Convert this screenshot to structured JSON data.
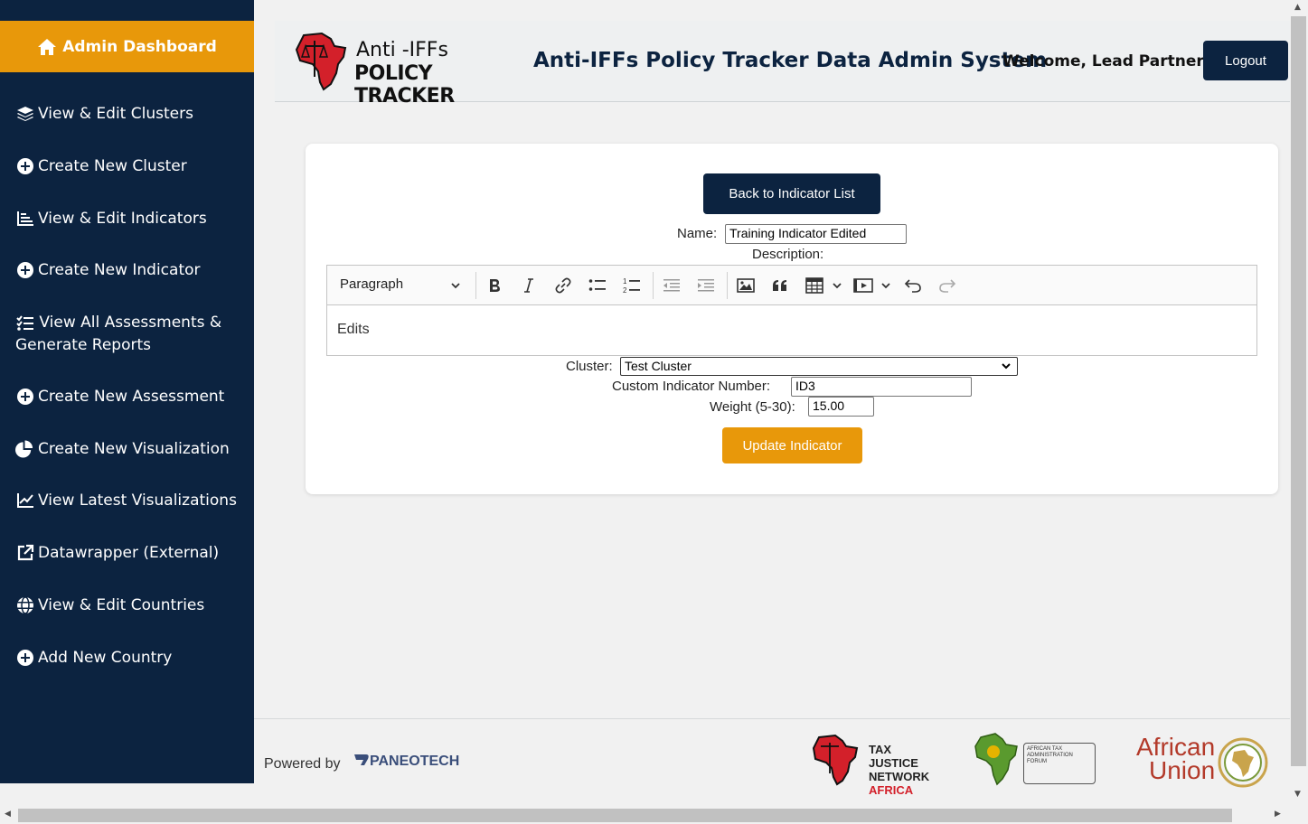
{
  "sidebar": {
    "dashboard_label": "Admin Dashboard",
    "items": [
      {
        "label": "View & Edit Clusters",
        "icon": "layers-icon"
      },
      {
        "label": "Create New Cluster",
        "icon": "plus-circle-icon"
      },
      {
        "label": "View & Edit Indicators",
        "icon": "bar-list-icon"
      },
      {
        "label": "Create New Indicator",
        "icon": "plus-circle-icon"
      },
      {
        "label": "View All Assessments & Generate Reports",
        "icon": "checklist-icon"
      },
      {
        "label": "Create New Assessment",
        "icon": "plus-circle-icon"
      },
      {
        "label": "Create New Visualization",
        "icon": "pie-chart-icon"
      },
      {
        "label": "View Latest Visualizations",
        "icon": "line-chart-icon"
      },
      {
        "label": "Datawrapper (External)",
        "icon": "external-link-icon"
      },
      {
        "label": "View & Edit Countries",
        "icon": "globe-icon"
      },
      {
        "label": "Add New Country",
        "icon": "plus-circle-icon"
      }
    ]
  },
  "header": {
    "logo_line1": "Anti -IFFs",
    "logo_line2": "POLICY TRACKER",
    "title": "Anti-IFFs Policy Tracker Data Admin System",
    "welcome": "Welcome, Lead Partner!",
    "logout_label": "Logout"
  },
  "form": {
    "back_label": "Back to Indicator List",
    "name_label": "Name:",
    "name_value": "Training Indicator Edited",
    "description_label": "Description:",
    "editor": {
      "paragraph_label": "Paragraph",
      "content": "Edits"
    },
    "cluster_label": "Cluster:",
    "cluster_value": "Test Cluster",
    "custom_number_label": "Custom Indicator Number:",
    "custom_number_value": "ID3",
    "weight_label": "Weight (5-30):",
    "weight_value": "15.00",
    "update_label": "Update Indicator"
  },
  "footer": {
    "powered_by": "Powered by",
    "paneo": "PANEOTECH",
    "tjn_line1": "TAX JUSTICE",
    "tjn_line2": "NETWORK",
    "tjn_line3": "AFRICA",
    "atf_line1": "AFRICAN TAX",
    "atf_line2": "ADMINISTRATION FORUM",
    "au_line1": "African",
    "au_line2": "Union"
  },
  "colors": {
    "navy": "#0c2340",
    "orange": "#e8980a",
    "red": "#d3202a"
  }
}
